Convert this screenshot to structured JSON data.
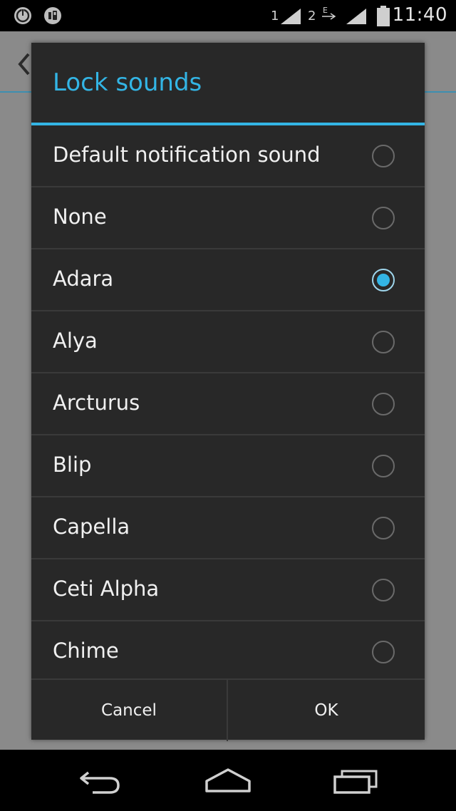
{
  "status_bar": {
    "time": "11:40",
    "sim1_label": "1",
    "sim2_label": "2",
    "icons": [
      "power-icon",
      "media-icon",
      "signal-sim1-icon",
      "data-icon",
      "signal-sim2-icon",
      "battery-icon"
    ]
  },
  "dialog": {
    "title": "Lock sounds",
    "options": [
      {
        "label": "Default notification sound",
        "selected": false
      },
      {
        "label": "None",
        "selected": false
      },
      {
        "label": "Adara",
        "selected": true
      },
      {
        "label": "Alya",
        "selected": false
      },
      {
        "label": "Arcturus",
        "selected": false
      },
      {
        "label": "Blip",
        "selected": false
      },
      {
        "label": "Capella",
        "selected": false
      },
      {
        "label": "Ceti Alpha",
        "selected": false
      },
      {
        "label": "Chime",
        "selected": false
      }
    ],
    "cancel_label": "Cancel",
    "ok_label": "OK"
  },
  "navigation": {
    "icons": [
      "back-icon",
      "home-icon",
      "recents-icon"
    ]
  },
  "colors": {
    "accent": "#33b5e5",
    "dialog_bg": "#282828",
    "text": "#f0f0f0"
  }
}
